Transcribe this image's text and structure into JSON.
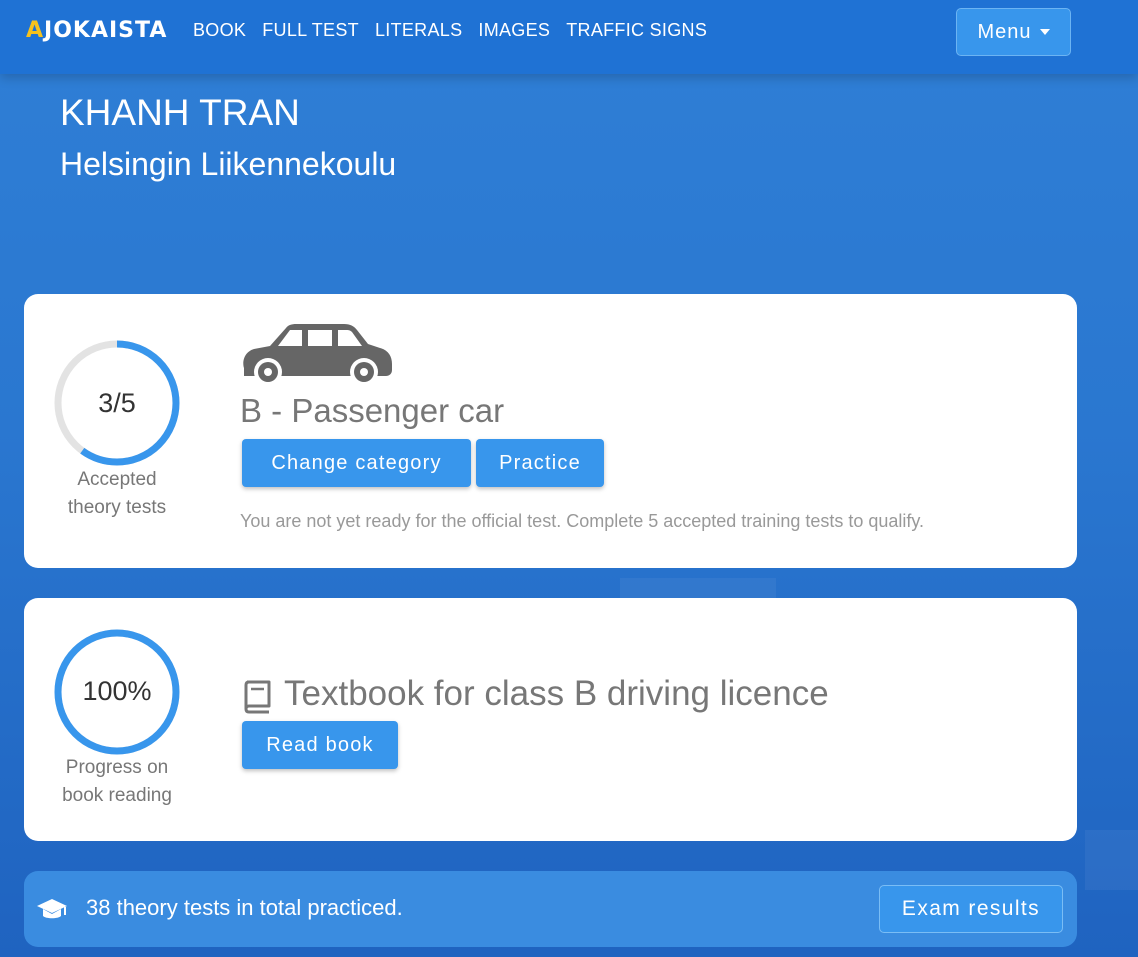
{
  "brand": {
    "first_letter": "A",
    "rest": "JOKAISTA"
  },
  "nav": {
    "links": [
      "BOOK",
      "FULL TEST",
      "LITERALS",
      "IMAGES",
      "TRAFFIC SIGNS"
    ],
    "menu_label": "Menu"
  },
  "user": {
    "name": "KHANH TRAN",
    "school": "Helsingin Liikennekoulu"
  },
  "category_card": {
    "progress_value": "3/5",
    "progress_fraction": 0.6,
    "caption_line1": "Accepted",
    "caption_line2": "theory tests",
    "title": "B - Passenger car",
    "change_button": "Change category",
    "practice_button": "Practice",
    "note": "You are not yet ready for the official test. Complete 5 accepted training tests to qualify."
  },
  "book_card": {
    "progress_value": "100%",
    "progress_fraction": 1.0,
    "caption_line1": "Progress on",
    "caption_line2": "book reading",
    "title": "Textbook for class B driving licence",
    "read_button": "Read book"
  },
  "footer": {
    "text": "38 theory tests in total practiced.",
    "exam_button": "Exam results"
  },
  "colors": {
    "accent": "#3896ec",
    "brand_yellow": "#f6c21c",
    "ring_track": "#e3e3e3",
    "icon_gray": "#666666"
  }
}
